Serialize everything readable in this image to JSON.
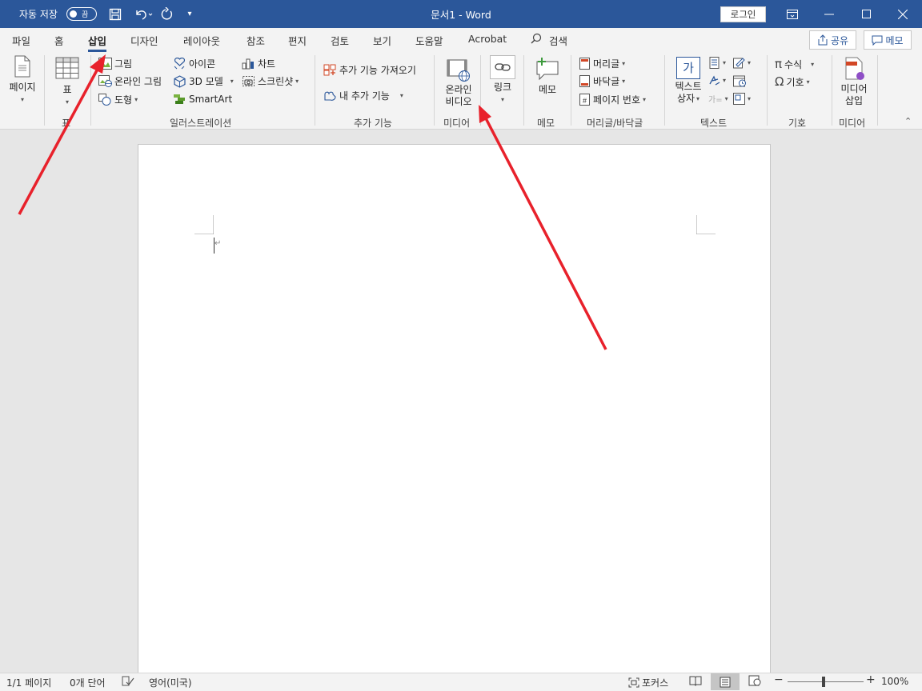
{
  "titlebar": {
    "autosave_label": "자동 저장",
    "autosave_state": "끔",
    "title": "문서1  -  Word",
    "login": "로그인"
  },
  "tabs": [
    "파일",
    "홈",
    "삽입",
    "디자인",
    "레이아웃",
    "참조",
    "편지",
    "검토",
    "보기",
    "도움말",
    "Acrobat",
    "검색"
  ],
  "active_tab": "삽입",
  "share": "공유",
  "memo_top": "메모",
  "ribbon": {
    "page": "페이지",
    "table": "표",
    "picture": "그림",
    "online_picture": "온라인 그림",
    "shapes": "도형",
    "icons": "아이콘",
    "model3d": "3D 모델",
    "smartart": "SmartArt",
    "chart": "차트",
    "screenshot": "스크린샷",
    "get_addins": "추가 기능 가져오기",
    "my_addins": "내 추가 기능",
    "online_video": "온라인 비디오",
    "online_video_l1": "온라인",
    "online_video_l2": "비디오",
    "link": "링크",
    "comment": "메모",
    "header": "머리글",
    "footer": "바닥글",
    "page_number": "페이지 번호",
    "textbox_l1": "텍스트",
    "textbox_l2": "상자",
    "equation": "수식",
    "symbol": "기호",
    "media_insert_l1": "미디어",
    "media_insert_l2": "삽입",
    "groups": {
      "table": "표",
      "illustrations": "일러스트레이션",
      "addins": "추가 기능",
      "media": "미디어",
      "comments": "메모",
      "header_footer": "머리글/바닥글",
      "text": "텍스트",
      "symbols": "기호",
      "media2": "미디어"
    }
  },
  "status": {
    "page": "1/1 페이지",
    "words": "0개 단어",
    "language": "영어(미국)",
    "focus": "포커스",
    "zoom": "100%"
  },
  "colors": {
    "titlebar": "#2b579a",
    "arrow": "#e8212b"
  }
}
